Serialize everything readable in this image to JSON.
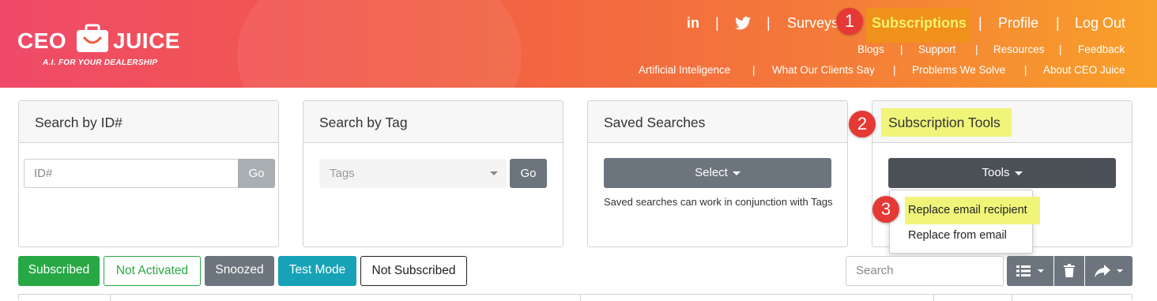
{
  "brand": {
    "name_left": "CEO",
    "name_right": "JUICE",
    "tagline": "A.I. FOR YOUR DEALERSHIP"
  },
  "nav": {
    "top": {
      "linkedin": "in",
      "surveys": "Surveys",
      "subscriptions": "Subscriptions",
      "profile": "Profile",
      "logout": "Log Out"
    },
    "row2": [
      "Blogs",
      "Support",
      "Resources",
      "Feedback"
    ],
    "row3": [
      "Artificial Inteligence",
      "What Our Clients Say",
      "Problems We Solve",
      "About CEO Juice"
    ],
    "separator": "|"
  },
  "steps": [
    "1",
    "2",
    "3"
  ],
  "panels": {
    "search_id": {
      "title": "Search by ID#",
      "placeholder": "ID#",
      "go": "Go"
    },
    "search_tag": {
      "title": "Search by Tag",
      "placeholder": "Tags",
      "go": "Go"
    },
    "saved": {
      "title": "Saved Searches",
      "select": "Select",
      "note": "Saved searches can work in conjunction with Tags"
    },
    "tools": {
      "title": "Subscription Tools",
      "button": "Tools",
      "menu": [
        "Replace email recipient",
        "Replace from email"
      ]
    }
  },
  "filters": [
    "Subscribed",
    "Not Activated",
    "Snoozed",
    "Test Mode",
    "Not Subscribed"
  ],
  "table_search": {
    "placeholder": "Search"
  },
  "colors": {
    "green": "#28a745",
    "gray": "#6c757d",
    "teal": "#17a2b8",
    "dark": "#4b5157",
    "highlight": "#f0f57a",
    "badge": "#e53935"
  }
}
